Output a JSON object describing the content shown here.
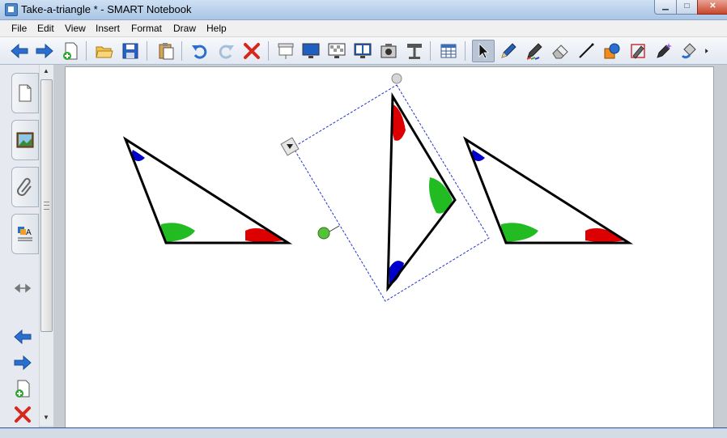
{
  "window": {
    "title": "Take-a-triangle * - SMART Notebook",
    "minimize_glyph": "▁",
    "maximize_glyph": "□",
    "close_glyph": "✕"
  },
  "menu": [
    "File",
    "Edit",
    "View",
    "Insert",
    "Format",
    "Draw",
    "Help"
  ],
  "toolbar": {
    "buttons": [
      "back-arrow-icon",
      "forward-arrow-icon",
      "add-page-icon",
      "open-folder-icon",
      "save-icon",
      "paste-icon",
      "undo-icon",
      "redo-icon",
      "delete-icon",
      "screen-shade-icon",
      "full-screen-icon",
      "transparent-background-icon",
      "dual-page-icon",
      "screen-capture-icon",
      "document-camera-icon",
      "table-icon",
      "select-pointer-icon",
      "pen-icon",
      "creative-pen-icon",
      "eraser-icon",
      "line-icon",
      "shape-icon",
      "magic-pen-icon",
      "highlighter-icon",
      "fill-icon",
      "more-icon"
    ],
    "active_tool": "select-pointer-icon"
  },
  "sidebar": {
    "tabs": [
      "page-sorter-icon",
      "gallery-icon",
      "attachments-icon",
      "properties-icon"
    ],
    "buttons": [
      "resize-arrows-icon",
      "previous-page-icon",
      "next-page-icon",
      "add-page-icon",
      "delete-page-icon"
    ]
  },
  "canvas": {
    "triangles": [
      "left-triangle",
      "rotated-triangle",
      "right-triangle"
    ],
    "angle_colors": {
      "top": "#0000cc",
      "left": "#22bb22",
      "right": "#dd0000"
    },
    "selection_color": "#2233cc"
  }
}
